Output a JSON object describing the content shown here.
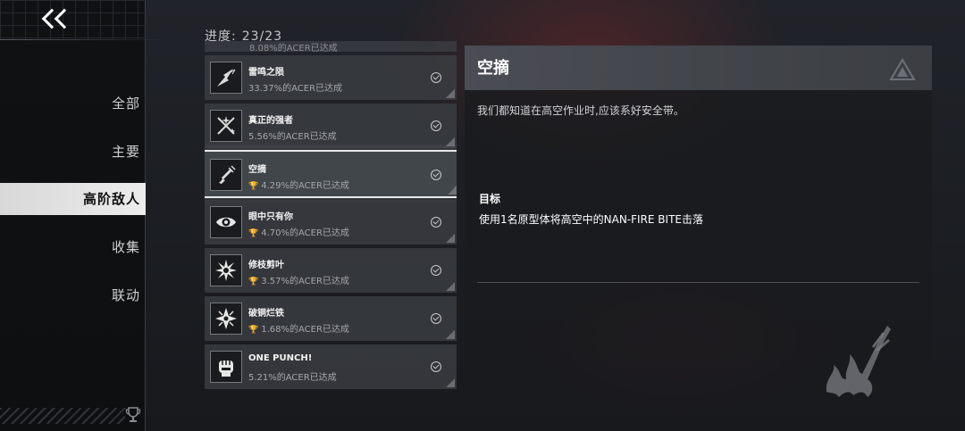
{
  "nav": {
    "back_icon": "double-chevron-left-icon",
    "items": [
      {
        "label": "全部",
        "active": false
      },
      {
        "label": "主要",
        "active": false
      },
      {
        "label": "高阶敌人",
        "active": true
      },
      {
        "label": "收集",
        "active": false
      },
      {
        "label": "联动",
        "active": false
      }
    ],
    "footer_icon": "trophy-icon"
  },
  "progress": {
    "label": "进度:",
    "value": "23/23"
  },
  "partial_row": {
    "subtitle": "8.08%的ACER已达成"
  },
  "achievements": [
    {
      "title": "雷鸣之陨",
      "subtitle": "33.37%的ACER已达成",
      "icon": "lightning-blade-icon",
      "completed": true,
      "trophy": false,
      "selected": false
    },
    {
      "title": "真正的强者",
      "subtitle": "5.56%的ACER已达成",
      "icon": "crossed-swords-sparkle-icon",
      "completed": true,
      "trophy": false,
      "selected": false
    },
    {
      "title": "空摘",
      "subtitle": "4.29%的ACER已达成",
      "icon": "falling-drone-icon",
      "completed": true,
      "trophy": true,
      "selected": true
    },
    {
      "title": "眼中只有你",
      "subtitle": "4.70%的ACER已达成",
      "icon": "eye-icon",
      "completed": true,
      "trophy": true,
      "selected": false
    },
    {
      "title": "修枝剪叶",
      "subtitle": "3.57%的ACER已达成",
      "icon": "burst-icon",
      "completed": true,
      "trophy": true,
      "selected": false
    },
    {
      "title": "破铜烂铁",
      "subtitle": "1.68%的ACER已达成",
      "icon": "shuriken-icon",
      "completed": true,
      "trophy": true,
      "selected": false
    },
    {
      "title": "ONE PUNCH!",
      "subtitle": "5.21%的ACER已达成",
      "icon": "fist-icon",
      "completed": true,
      "trophy": false,
      "selected": false
    }
  ],
  "detail": {
    "title": "空摘",
    "description": "我们都知道在高空作业时,应该系好安全带。",
    "goal_label": "目标",
    "goal_text": "使用1名原型体将高空中的NAN-FIRE BITE击落",
    "corner_icon": "triangle-logo-icon",
    "emblem_icon": "flaming-drone-emblem-icon"
  },
  "colors": {
    "selected_nav_bg": "#e6e6e6",
    "row_bg": "#3c3f44",
    "accent_red": "#962828"
  }
}
